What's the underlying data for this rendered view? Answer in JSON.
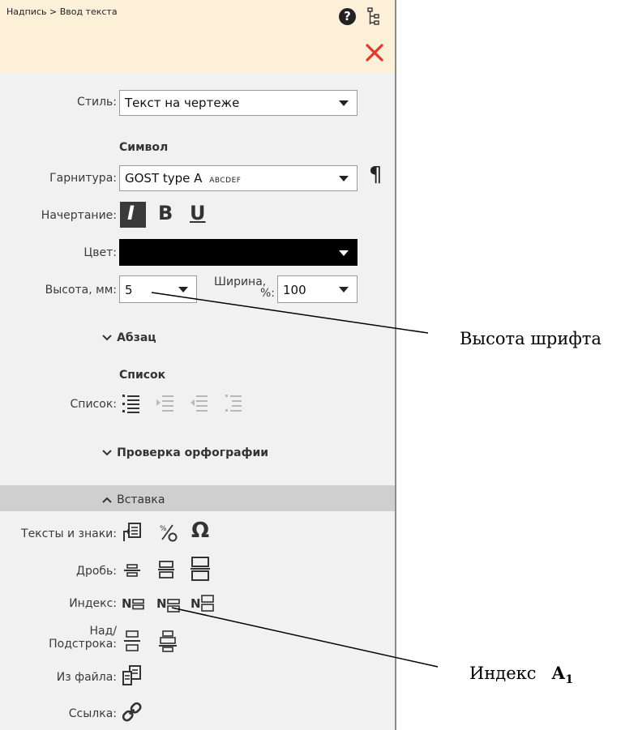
{
  "header": {
    "breadcrumb": "Надпись > Ввод текста",
    "help_glyph": "?",
    "icons": [
      "help-icon",
      "tree-icon",
      "close-icon"
    ]
  },
  "style_row": {
    "label": "Стиль:",
    "value": "Текст на чертеже"
  },
  "symbol": {
    "heading": "Символ",
    "font_label": "Гарнитура:",
    "font_value": "GOST type A",
    "font_sample": "ABCDEF",
    "paragraph_glyph": "¶",
    "style_label": "Начертание:",
    "italic": "I",
    "bold": "B",
    "underline": "U",
    "color_label": "Цвет:",
    "color_value": "#000000",
    "height_label": "Высота, мм:",
    "height_value": "5",
    "width_label": "Ширина,",
    "width_unit": "%:",
    "width_value": "100"
  },
  "sections": {
    "paragraph": "Абзац",
    "list_heading": "Список",
    "list_label": "Список:",
    "spellcheck": "Проверка орфографии",
    "insert": "Вставка"
  },
  "insert": {
    "texts_label": "Тексты и знаки:",
    "omega": "Ω",
    "fraction_label": "Дробь:",
    "index_label": "Индекс:",
    "index_letter": "N",
    "supsub_label_1": "Над/",
    "supsub_label_2": "Подстрока:",
    "file_label": "Из файла:",
    "link_label": "Ссылка:"
  },
  "annotations": {
    "font_height": "Высота шрифта",
    "index": "Индекс",
    "index_base": "А",
    "index_sub": "1"
  },
  "colors": {
    "header_bg": "#fdf0d8",
    "close": "#e8352a",
    "panel_bg": "#f1f1f1",
    "insert_bar": "#cfcfcf",
    "icon": "#333333"
  }
}
